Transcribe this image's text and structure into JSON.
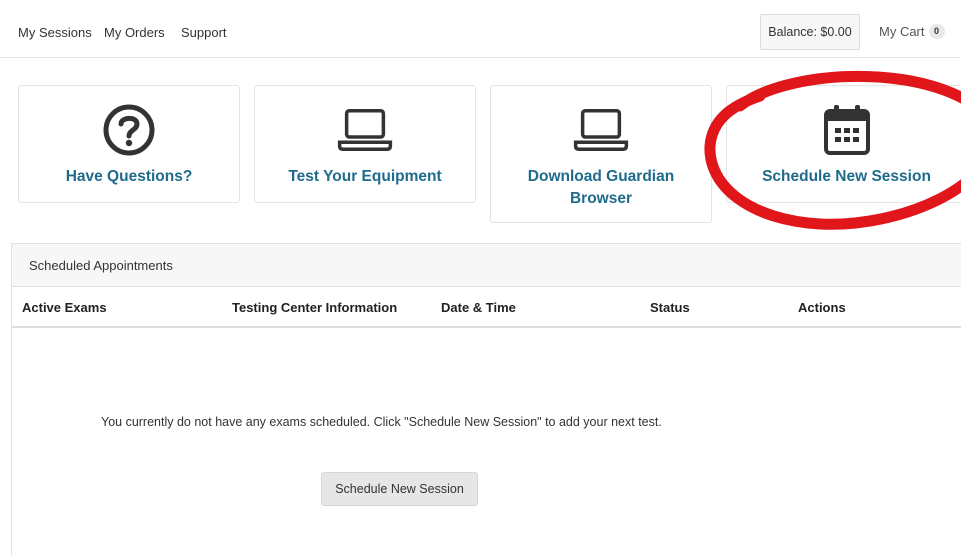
{
  "nav": {
    "links": [
      "My Sessions",
      "My Orders",
      "Support"
    ],
    "balance": "Balance: $0.00",
    "cart_label": "My Cart",
    "cart_count": "0"
  },
  "tiles": [
    {
      "label": "Have Questions?",
      "icon": "question-circle-icon"
    },
    {
      "label": "Test Your Equipment",
      "icon": "laptop-icon"
    },
    {
      "label": "Download Guardian Browser",
      "icon": "laptop-icon"
    },
    {
      "label": "Schedule New Session",
      "icon": "calendar-icon"
    }
  ],
  "appointments": {
    "title": "Scheduled Appointments",
    "columns": [
      "Active Exams",
      "Testing Center Information",
      "Date & Time",
      "Status",
      "Actions"
    ],
    "empty_message": "You currently do not have any exams scheduled. Click \"Schedule New Session\" to add your next test.",
    "button_label": "Schedule New Session"
  },
  "colors": {
    "link_blue": "#1f6b8c",
    "icon_dark": "#333333",
    "highlight_red": "#e0161b"
  }
}
